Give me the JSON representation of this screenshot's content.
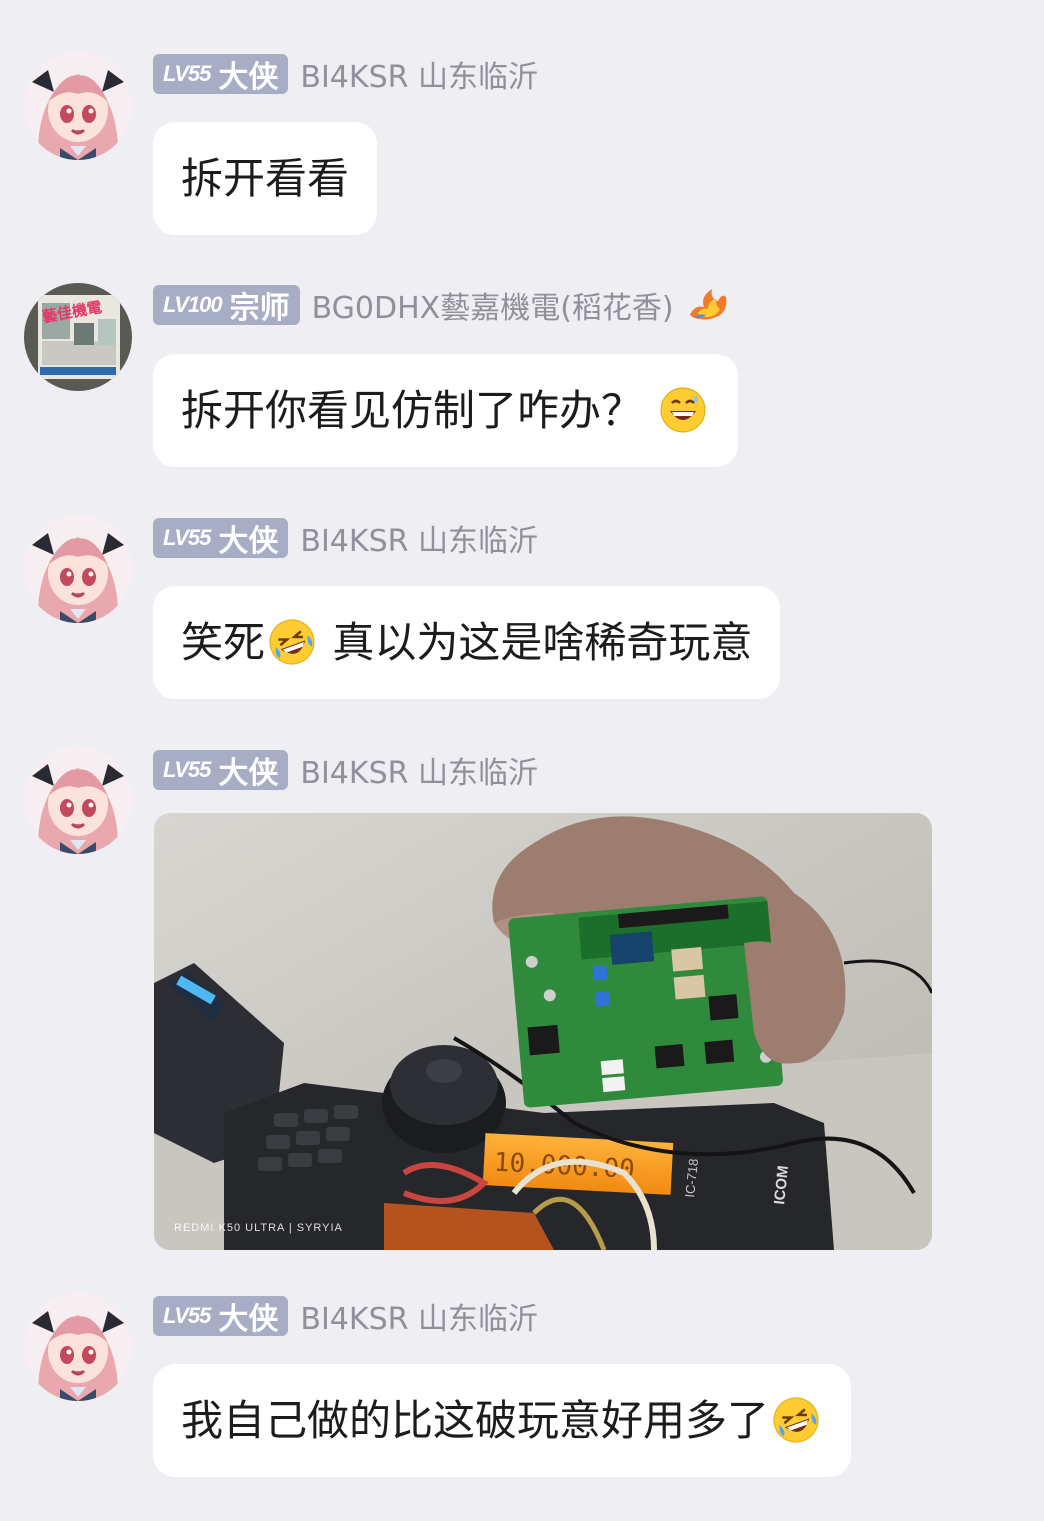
{
  "messages": [
    {
      "level": "LV55",
      "title": "大侠",
      "sender": "BI4KSR 山东临沂",
      "text": "拆开看看"
    },
    {
      "level": "LV100",
      "title": "宗师",
      "sender": "BG0DHX藝嘉機電(稻花香)",
      "avatar_text": "藝佳機電",
      "text": "拆开你看见仿制了咋办？"
    },
    {
      "level": "LV55",
      "title": "大侠",
      "sender": "BI4KSR 山东临沂",
      "text_before": "笑死",
      "text_after": " 真以为这是啥稀奇玩意"
    },
    {
      "level": "LV55",
      "title": "大侠",
      "sender": "BI4KSR 山东临沂",
      "photo_watermark": "REDMI K50 ULTRA | SYRYIA",
      "radio_label": "ICOM",
      "radio_model": "IC-718",
      "display_text": "10.000.00"
    },
    {
      "level": "LV55",
      "title": "大侠",
      "sender": "BI4KSR 山东临沂",
      "text": "我自己做的比这破玩意好用多了"
    }
  ],
  "colors": {
    "background": "#eeeef3",
    "badge": "#a7adc5",
    "bubble": "#ffffff",
    "sender_text": "#8f909a",
    "message_text": "#1c1c1e"
  },
  "icons": [
    "avatar-anime-girl",
    "avatar-shop-sign",
    "fire-emoji",
    "grinning-sweat-emoji",
    "rolling-laughing-emoji"
  ]
}
